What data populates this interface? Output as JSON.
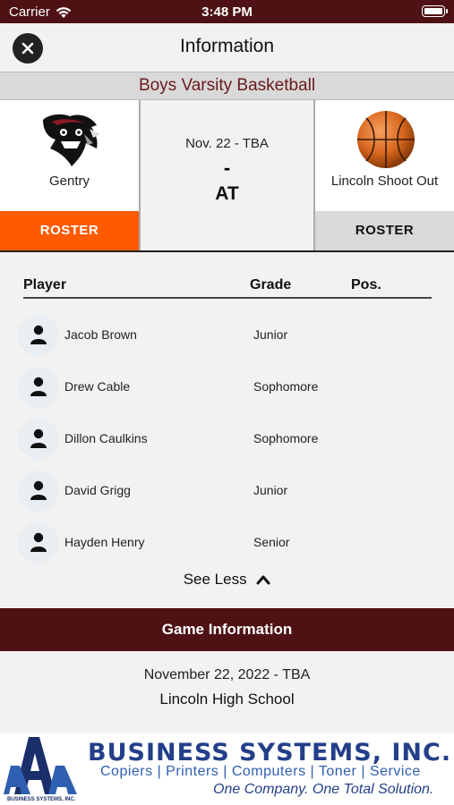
{
  "status_bar": {
    "carrier": "Carrier",
    "time": "3:48 PM"
  },
  "nav": {
    "title": "Information"
  },
  "event": {
    "banner": "Boys Varsity Basketball",
    "date_time": "Nov. 22 - TBA",
    "score": "-",
    "location_tag": "AT"
  },
  "home_team": {
    "name": "Gentry",
    "roster_label": "ROSTER",
    "roster_color": "#fe5a00"
  },
  "away_team": {
    "name": "Lincoln Shoot Out",
    "roster_label": "ROSTER"
  },
  "roster": {
    "headers": {
      "player": "Player",
      "grade": "Grade",
      "position": "Pos."
    },
    "players": [
      {
        "name": "Jacob Brown",
        "grade": "Junior"
      },
      {
        "name": "Drew Cable",
        "grade": "Sophomore"
      },
      {
        "name": "Dillon Caulkins",
        "grade": "Sophomore"
      },
      {
        "name": "David Grigg",
        "grade": "Junior"
      },
      {
        "name": "Hayden Henry",
        "grade": "Senior"
      }
    ],
    "toggle_label": "See Less"
  },
  "game_information": {
    "heading": "Game Information",
    "date_time": "November 22, 2022 - TBA",
    "venue": "Lincoln High School"
  },
  "ad": {
    "company": "BUSINESS SYSTEMS, INC.",
    "services": "Copiers | Printers | Computers | Toner | Service",
    "slogan": "One Company. One Total Solution.",
    "logo_caption": "BUSINESS SYSTEMS, INC."
  },
  "colors": {
    "brand_maroon": "#4e1214",
    "banner_text": "#6b1a1e"
  }
}
